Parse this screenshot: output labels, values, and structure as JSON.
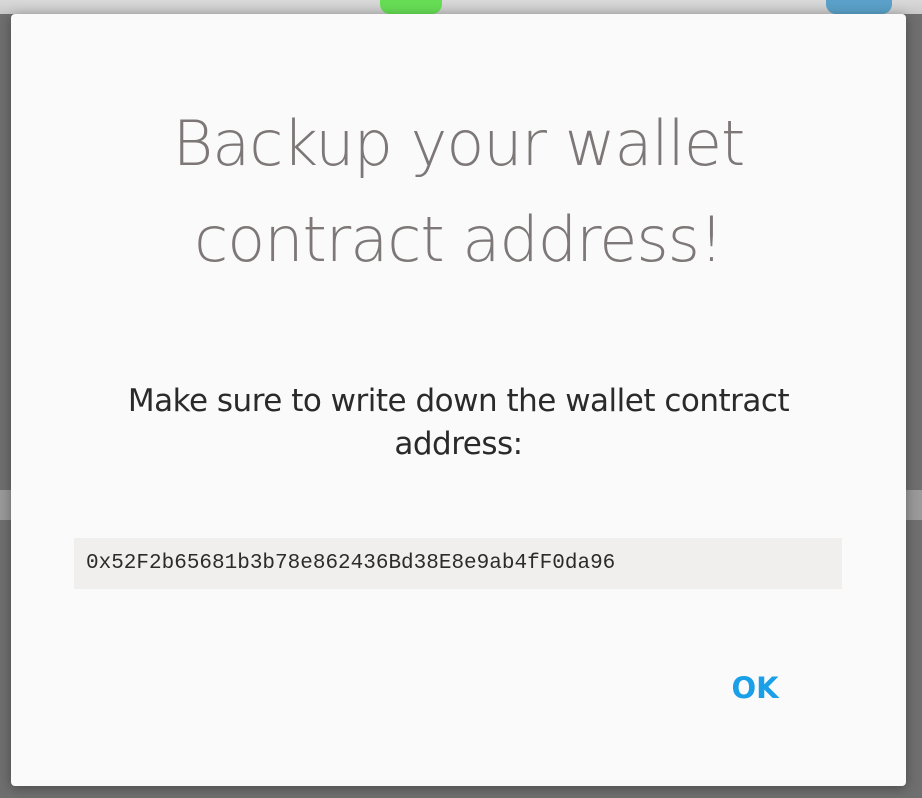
{
  "dialog": {
    "title_line1": "Backup your wallet",
    "title_line2": "contract address!",
    "message": "Make sure to write down the wallet contract address:",
    "address": "0x52F2b65681b3b78e862436Bd38E8e9ab4fF0da96",
    "ok_label": "OK"
  },
  "colors": {
    "title": "#7d7777",
    "ok_button": "#1aa0e8",
    "address_background": "#f1efee",
    "dialog_background": "#fafafa"
  }
}
